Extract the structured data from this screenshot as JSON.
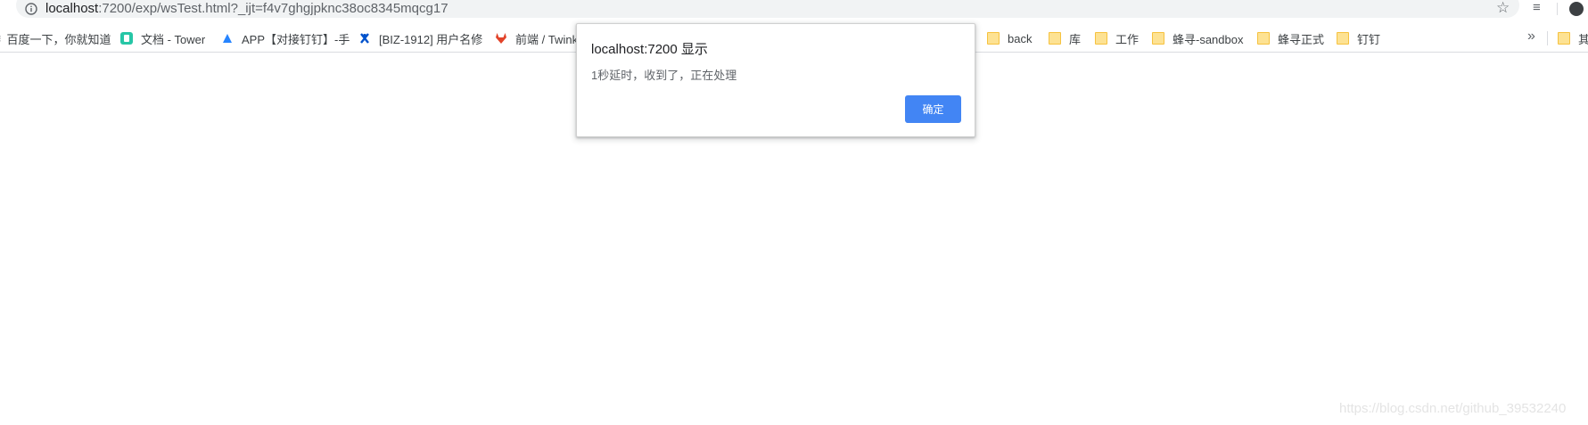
{
  "address_bar": {
    "host": "localhost",
    "rest": ":7200/exp/wsTest.html?_ijt=f4v7ghgjpknc38oc8345mqcg17"
  },
  "icons": {
    "info": "info-icon",
    "star": "star-icon",
    "menu": "menu-icon",
    "profile": "profile-icon",
    "overflow": "chevron-double-right-icon"
  },
  "bookmarks": {
    "items": [
      {
        "label": "百度一下，你就知道",
        "icon": "baidu-icon"
      },
      {
        "label": "文档 - Tower",
        "icon": "tower-icon"
      },
      {
        "label": "APP【对接钉钉】-手",
        "icon": "jira-icon"
      },
      {
        "label": "[BIZ-1912] 用户名修",
        "icon": "jira-bug-icon"
      },
      {
        "label": "前端 / Twink",
        "icon": "gitlab-icon"
      },
      {
        "label": "back",
        "icon": "folder-icon"
      },
      {
        "label": "库",
        "icon": "folder-icon"
      },
      {
        "label": "工作",
        "icon": "folder-icon"
      },
      {
        "label": "蜂寻-sandbox",
        "icon": "folder-icon"
      },
      {
        "label": "蜂寻正式",
        "icon": "folder-icon"
      },
      {
        "label": "钉钉",
        "icon": "folder-icon"
      },
      {
        "label": "其",
        "icon": "folder-icon"
      }
    ],
    "overflow_glyph": "»"
  },
  "dialog": {
    "title": "localhost:7200 显示",
    "message": "1秒延时，收到了，正在处理",
    "ok_label": "确定"
  },
  "watermark": "https://blog.csdn.net/github_39532240",
  "colors": {
    "accent": "#4285f4",
    "folder": "#fde293"
  }
}
